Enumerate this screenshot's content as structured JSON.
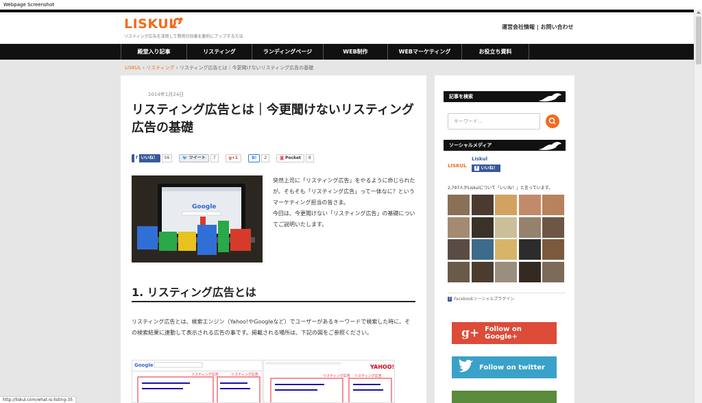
{
  "window_title": "Webpage Screenshot",
  "status_url": "http://liskul.com/what-is-listing-35",
  "header": {
    "logo": "LISKUL",
    "tagline": "リスティング広告を活用して費用対効果を劇的にアップする方法",
    "links": "運営会社情報 | お問い合わせ"
  },
  "nav": {
    "items": [
      "殿堂入り記事",
      "リスティング",
      "ランディングページ",
      "WEB制作",
      "WEBマーケティング",
      "お役立ち資料"
    ]
  },
  "breadcrumb": {
    "home": "LISKUL",
    "category": "リスティング",
    "current": "リスティング広告とは｜今更聞けないリスティング広告の基礎",
    "sep": " › "
  },
  "article": {
    "date": "2014年1月24日",
    "title": "リスティング広告とは｜今更聞けないリスティング広告の基礎",
    "intro": "突然上司に「リスティング広告」をやるように命じられたが、そもそも「リスティング広告」って一体なに？というマーケティング担当の皆さま。\n今回は、今更聞けない「リスティング広告」の基礎についてご説明いたします。",
    "h2": "1.  リスティング広告とは",
    "body": "リスティング広告とは、検索エンジン（Yahoo!やGoogleなど）でユーザーがあるキーワードで検索した時に、その検索結果に連動して表示される広告の事です。掲載される場所は、下記の図をご参照ください。",
    "social": {
      "like_label": "いいね！",
      "like_count": "56",
      "tweet_label": "ツイート",
      "tweet_count": "7",
      "gplus_label": "g+1",
      "hatena_label": "B!",
      "hatena_count": "2",
      "pocket_label": "Pocket",
      "pocket_count": "8"
    },
    "shot_label": "リスティング広告"
  },
  "sidebar": {
    "search_title": "記事を検索",
    "search_placeholder": "キーワード...",
    "social_title": "ソーシャルメディア",
    "fb_name": "Liskul",
    "fb_like": "いいね！",
    "fb_count_text": "2,797人がLiskulについて「いいね！」と言っています。",
    "fb_plugin": "Facebookソーシャルプラグイン",
    "gplus_button": "Follow on Google+",
    "twitter_button": "Follow on twitter",
    "logo_small": "LISKUL"
  },
  "colors": {
    "accent": "#f26b1d",
    "nav_bg": "#111111",
    "gplus": "#dd4b39",
    "twitter": "#3aa1c9"
  }
}
